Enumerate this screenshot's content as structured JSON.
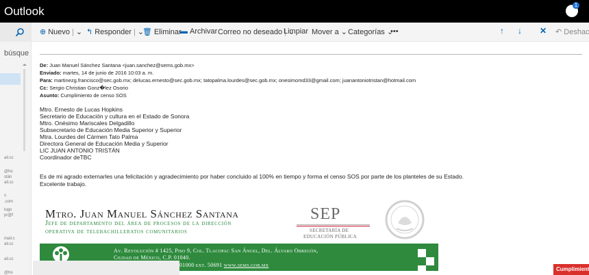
{
  "app": {
    "title": "Outlook",
    "notification_count": "1"
  },
  "left": {
    "search_label": "búsque",
    "fragments": [
      "ail.cc",
      "@ho",
      "stán",
      "ail.cc",
      "s",
      ".com",
      "lugo",
      "pr@f",
      "mail.c",
      "ail.cc",
      "ail.cc",
      "@ho"
    ]
  },
  "toolbar": {
    "nuevo": "Nuevo",
    "responder": "Responder",
    "eliminar": "Eliminar",
    "archivar": "Archivar",
    "correo_no_deseado": "Correo no deseado",
    "limpiar": "Limpiar",
    "mover_a": "Mover a",
    "categorias": "Categorías",
    "more": "•••",
    "deshacer": "Deshacer"
  },
  "email": {
    "de_label": "De:",
    "de_value": "Juan Manuel Sánchez Santana <juan.sanchez@sems.gob.mx>",
    "enviado_label": "Enviado:",
    "enviado_value": "martes, 14 de junio de 2016 10:03 a. m.",
    "para_label": "Para:",
    "para_value": "martinezg.francisco@sec.gob.mx; delucas.ernesto@sec.gob.mx; tatopalma.lourdes@sec.gob.mx; onesimomd33@gmail.com; juanantoniotristan@hotmail.com",
    "cc_label": "Cc:",
    "cc_value": "Sergio Christian Gonz�lez Osorio",
    "asunto_label": "Asunto:",
    "asunto_value": "Cumplimiento de censo SOS",
    "body_lines": [
      "Mtro. Ernesto de Lucas Hopkins",
      "Secretario de Educación y cultura en el Estado de Sonora",
      "Mtro. Onésimo Mariscales Delgadillo",
      "Subsecretario de Educación Media Superior y Superior",
      "Mtra. Lourdes del Cármen Tato Palma",
      "Directora General de Educación Media y Superior",
      "LIC JUAN ANTONIO TRISTÁN",
      "Coordinador deTBC"
    ],
    "paragraph": "Es de mi agrado externarles una felicitación y agradecimiento por haber concluido al 100% en tiempo y forma el censo SOS por parte de los planteles de su Estado.",
    "closing": "Excelente trabajo."
  },
  "signature": {
    "name": "Mtro. Juan Manuel Sánchez Santana",
    "title_line1": "Jefe de departamento del área de procesos de la dirección",
    "title_line2": "operativa de telebachilleratos comunitarios",
    "sep_logo": "SEP",
    "sep_sub1": "SECRETARÍA DE",
    "sep_sub2": "EDUCACIÓN PÚBLICA",
    "address_line1": "Av. Revolución # 1425, Piso 9, Col. Tlacopac San Ángel, Del. Álvaro Obregón,",
    "address_line2": "Ciudad de México, C.P. 01040.",
    "address_line3_prefix": "01000 ext. 50691 ",
    "website": "www.sems.gob.mx",
    "brand_green": "#2f8a3e"
  },
  "badge": {
    "label": "Cumplimiento"
  }
}
